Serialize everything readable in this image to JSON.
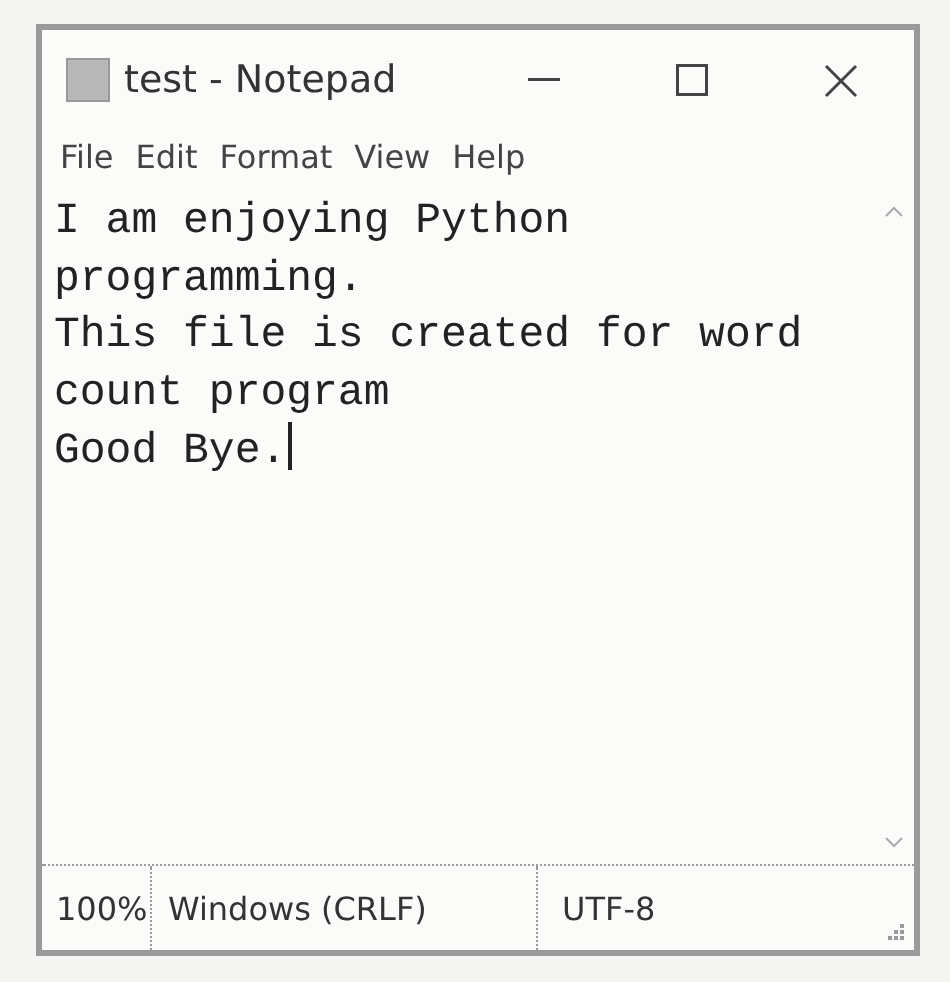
{
  "window": {
    "title": "test - Notepad"
  },
  "menu": [
    "File",
    "Edit",
    "Format",
    "View",
    "Help"
  ],
  "editor": {
    "lines": [
      "I am enjoying Python",
      "programming.",
      "This file is created for word",
      "count program",
      "Good Bye."
    ],
    "caret": true
  },
  "status_bar": {
    "zoom": "100%",
    "line_ending": "Windows (CRLF)",
    "encoding": "UTF-8"
  }
}
